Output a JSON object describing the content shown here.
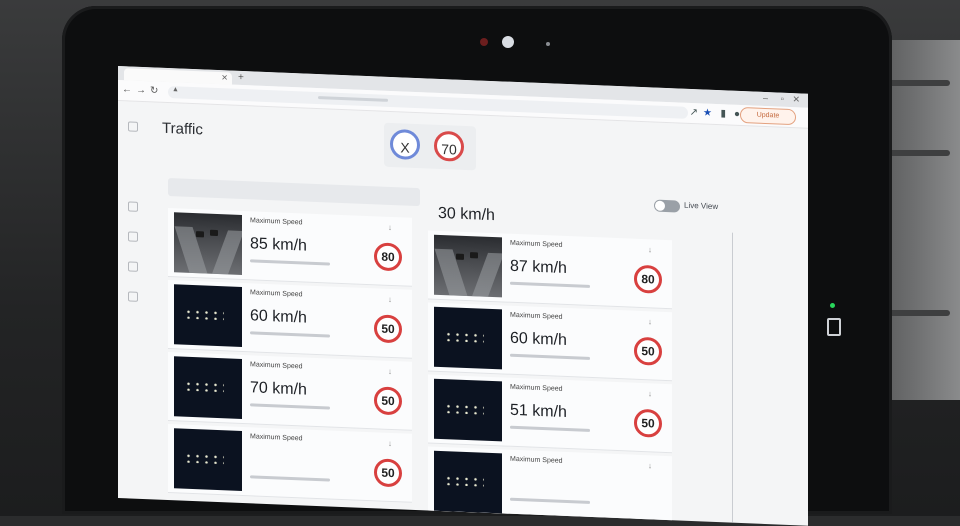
{
  "page": {
    "title": "Traffic"
  },
  "signs": {
    "cancel": "X",
    "limit": "70"
  },
  "live_view": {
    "label": "Live View",
    "on": false
  },
  "speed_header": "30 km/h",
  "toolbar": {
    "update_label": "Update"
  },
  "left_column": [
    {
      "label": "Maximum Speed",
      "speed": "85 km/h",
      "limit": "80",
      "arrow": "↓",
      "thumb": "road"
    },
    {
      "label": "Maximum Speed",
      "speed": "60 km/h",
      "limit": "50",
      "arrow": "↓",
      "thumb": "dark"
    },
    {
      "label": "Maximum Speed",
      "speed": "70 km/h",
      "limit": "50",
      "arrow": "↓",
      "thumb": "dark"
    },
    {
      "label": "Maximum Speed",
      "speed": "",
      "limit": "50",
      "arrow": "↓",
      "thumb": "dark"
    }
  ],
  "right_column": [
    {
      "label": "Maximum Speed",
      "speed": "87 km/h",
      "limit": "80",
      "arrow": "↓",
      "thumb": "road"
    },
    {
      "label": "Maximum Speed",
      "speed": "60 km/h",
      "limit": "50",
      "arrow": "↓",
      "thumb": "dark"
    },
    {
      "label": "Maximum Speed",
      "speed": "51 km/h",
      "limit": "50",
      "arrow": "↓",
      "thumb": "dark"
    },
    {
      "label": "Maximum Speed",
      "speed": "",
      "limit": "",
      "arrow": "↓",
      "thumb": "dark"
    }
  ],
  "colors": {
    "limit_ring": "#d8403f",
    "cancel_ring": "#6f8ad9",
    "update_accent": "#c4683c",
    "background": "#f4f5f6"
  },
  "icons": [
    "back-arrow-icon",
    "forward-arrow-icon",
    "reload-icon",
    "lock-icon",
    "extension-icon",
    "star-icon",
    "sidepanel-icon",
    "profile-icon"
  ]
}
